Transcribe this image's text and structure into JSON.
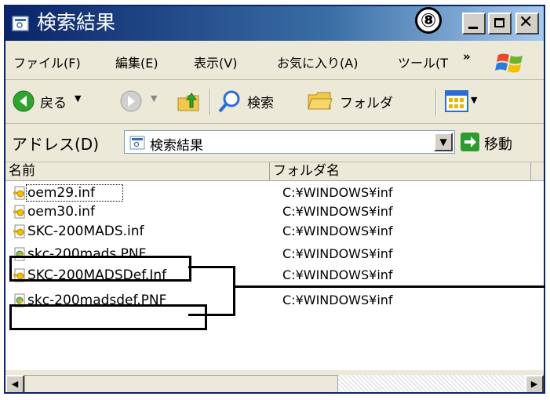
{
  "window": {
    "title": "検索結果",
    "callout_label": "⑧"
  },
  "menubar": {
    "items": [
      "ファイル(F)",
      "編集(E)",
      "表示(V)",
      "お気に入り(A)",
      "ツール(T"
    ],
    "overflow": "»"
  },
  "toolbar": {
    "back_label": "戻る",
    "search_label": "検索",
    "folder_label": "フォルダ"
  },
  "address": {
    "label": "アドレス(D)",
    "value": "検索結果",
    "go_label": "移動"
  },
  "columns": {
    "name": "名前",
    "folder": "フォルダ名"
  },
  "files": [
    {
      "name": "oem29.inf",
      "folder": "C:¥WINDOWS¥inf",
      "icon": "inf-file-icon"
    },
    {
      "name": "oem30.inf",
      "folder": "C:¥WINDOWS¥inf",
      "icon": "inf-file-icon"
    },
    {
      "name": "SKC-200MADS.inf",
      "folder": "C:¥WINDOWS¥inf",
      "icon": "inf-file-icon"
    },
    {
      "name": "skc-200mads.PNF",
      "folder": "C:¥WINDOWS¥inf",
      "icon": "pnf-file-icon"
    },
    {
      "name": "SKC-200MADSDef.Inf",
      "folder": "C:¥WINDOWS¥inf",
      "icon": "inf-file-icon"
    },
    {
      "name": "skc-200madsdef.PNF",
      "folder": "C:¥WINDOWS¥inf",
      "icon": "pnf-file-icon"
    }
  ],
  "colors": {
    "title_bar": "#0a246a",
    "highlight": "#000000"
  }
}
